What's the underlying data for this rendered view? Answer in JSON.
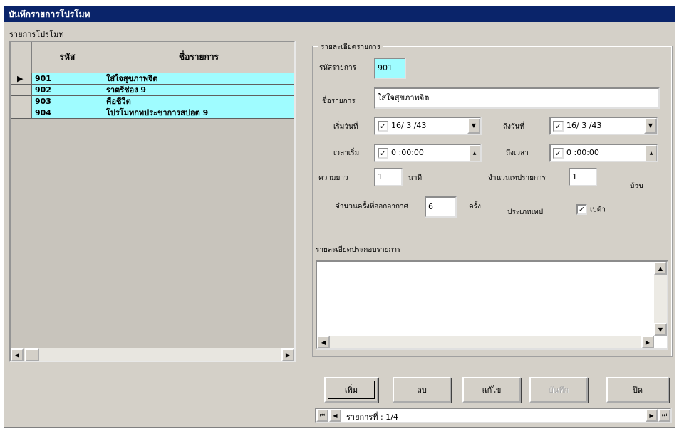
{
  "window": {
    "title": "บันทึกรายการโปรโมท"
  },
  "list": {
    "label": "รายการโปรโมท",
    "columns": [
      "รหัส",
      "ชื่อรายการ"
    ],
    "rows": [
      {
        "indicator": "▶",
        "code": "901",
        "name": "ใส่ใจสุขภาพจิต"
      },
      {
        "indicator": "",
        "code": "902",
        "name": "ราตรีช่อง 9"
      },
      {
        "indicator": "",
        "code": "903",
        "name": "คือชีวิต"
      },
      {
        "indicator": "",
        "code": "904",
        "name": "โปรโมทกทประชาการสปอต 9"
      }
    ]
  },
  "details": {
    "group_title": "รายละเอียดรายการ",
    "code_label": "รหัสรายการ",
    "code_value": "901",
    "name_label": "ชื่อรายการ",
    "name_value": "ใส่ใจสุขภาพจิต",
    "start_date_label": "เริ่มวันที่",
    "start_date_value": "16/ 3 /43",
    "end_date_label": "ถึงวันที่",
    "end_date_value": "16/ 3 /43",
    "start_time_label": "เวลาเริ่ม",
    "start_time_value": "0 :00:00",
    "end_time_label": "ถึงเวลา",
    "end_time_value": "0 :00:00",
    "length_label": "ความยาว",
    "length_value": "1",
    "length_unit": "นาที",
    "tape_count_label": "จำนวนเทปรายการ",
    "tape_count_value": "1",
    "tape_unit": "ม้วน",
    "broadcast_count_label": "จำนวนครั้งที่ออกอากาศ",
    "broadcast_count_value": "6",
    "broadcast_unit": "ครั้ง",
    "tape_type_label": "ประเภทเทป",
    "tape_type_option": "เบต้า",
    "check_mark": "✓",
    "desc_label": "รายละเอียดประกอบรายการ",
    "desc_value": ""
  },
  "buttons": {
    "add": "เพิ่ม",
    "delete": "ลบ",
    "edit": "แก้ไข",
    "save": "บันทึก",
    "close": "ปิด"
  },
  "navigator": {
    "record_text": "รายการที่ : 1/4",
    "first_icon": "⏮",
    "prev_icon": "◀",
    "next_icon": "▶",
    "last_icon": "⏭"
  }
}
